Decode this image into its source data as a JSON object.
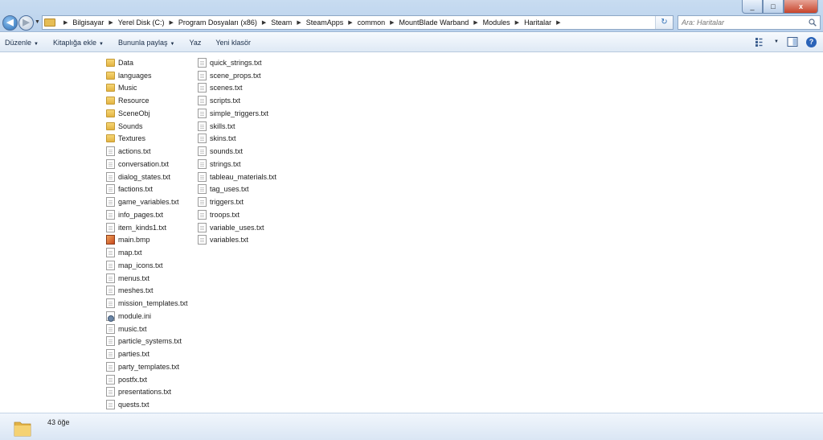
{
  "window": {
    "minimize_label": "_",
    "maximize_label": "□",
    "close_label": "x"
  },
  "nav": {
    "back_glyph": "◀",
    "forward_glyph": "▶",
    "dropdown_glyph": "▼"
  },
  "address": {
    "separator": "▶",
    "crumbs": [
      "Bilgisayar",
      "Yerel Disk (C:)",
      "Program Dosyaları (x86)",
      "Steam",
      "SteamApps",
      "common",
      "MountBlade Warband",
      "Modules",
      "Haritalar"
    ],
    "refresh_glyph": "↻"
  },
  "search": {
    "placeholder": "Ara: Haritalar"
  },
  "toolbar": {
    "organize": "Düzenle",
    "add_to_library": "Kitaplığa ekle",
    "share_with": "Bununla paylaş",
    "burn": "Yaz",
    "new_folder": "Yeni klasör",
    "dropdown_glyph": "▼",
    "help_glyph": "?"
  },
  "files": {
    "column1": [
      {
        "name": "Data",
        "type": "folder"
      },
      {
        "name": "languages",
        "type": "folder"
      },
      {
        "name": "Music",
        "type": "folder"
      },
      {
        "name": "Resource",
        "type": "folder"
      },
      {
        "name": "SceneObj",
        "type": "folder"
      },
      {
        "name": "Sounds",
        "type": "folder"
      },
      {
        "name": "Textures",
        "type": "folder"
      },
      {
        "name": "actions.txt",
        "type": "file"
      },
      {
        "name": "conversation.txt",
        "type": "file"
      },
      {
        "name": "dialog_states.txt",
        "type": "file"
      },
      {
        "name": "factions.txt",
        "type": "file"
      },
      {
        "name": "game_variables.txt",
        "type": "file"
      },
      {
        "name": "info_pages.txt",
        "type": "file"
      },
      {
        "name": "item_kinds1.txt",
        "type": "file"
      },
      {
        "name": "main.bmp",
        "type": "bmp"
      },
      {
        "name": "map.txt",
        "type": "file"
      },
      {
        "name": "map_icons.txt",
        "type": "file"
      },
      {
        "name": "menus.txt",
        "type": "file"
      },
      {
        "name": "meshes.txt",
        "type": "file"
      },
      {
        "name": "mission_templates.txt",
        "type": "file"
      },
      {
        "name": "module.ini",
        "type": "ini"
      },
      {
        "name": "music.txt",
        "type": "file"
      },
      {
        "name": "particle_systems.txt",
        "type": "file"
      },
      {
        "name": "parties.txt",
        "type": "file"
      },
      {
        "name": "party_templates.txt",
        "type": "file"
      },
      {
        "name": "postfx.txt",
        "type": "file"
      },
      {
        "name": "presentations.txt",
        "type": "file"
      },
      {
        "name": "quests.txt",
        "type": "file"
      }
    ],
    "column2": [
      {
        "name": "quick_strings.txt",
        "type": "file"
      },
      {
        "name": "scene_props.txt",
        "type": "file"
      },
      {
        "name": "scenes.txt",
        "type": "file"
      },
      {
        "name": "scripts.txt",
        "type": "file"
      },
      {
        "name": "simple_triggers.txt",
        "type": "file"
      },
      {
        "name": "skills.txt",
        "type": "file"
      },
      {
        "name": "skins.txt",
        "type": "file"
      },
      {
        "name": "sounds.txt",
        "type": "file"
      },
      {
        "name": "strings.txt",
        "type": "file"
      },
      {
        "name": "tableau_materials.txt",
        "type": "file"
      },
      {
        "name": "tag_uses.txt",
        "type": "file"
      },
      {
        "name": "triggers.txt",
        "type": "file"
      },
      {
        "name": "troops.txt",
        "type": "file"
      },
      {
        "name": "variable_uses.txt",
        "type": "file"
      },
      {
        "name": "variables.txt",
        "type": "file"
      }
    ]
  },
  "status": {
    "item_count": "43 öğe"
  }
}
